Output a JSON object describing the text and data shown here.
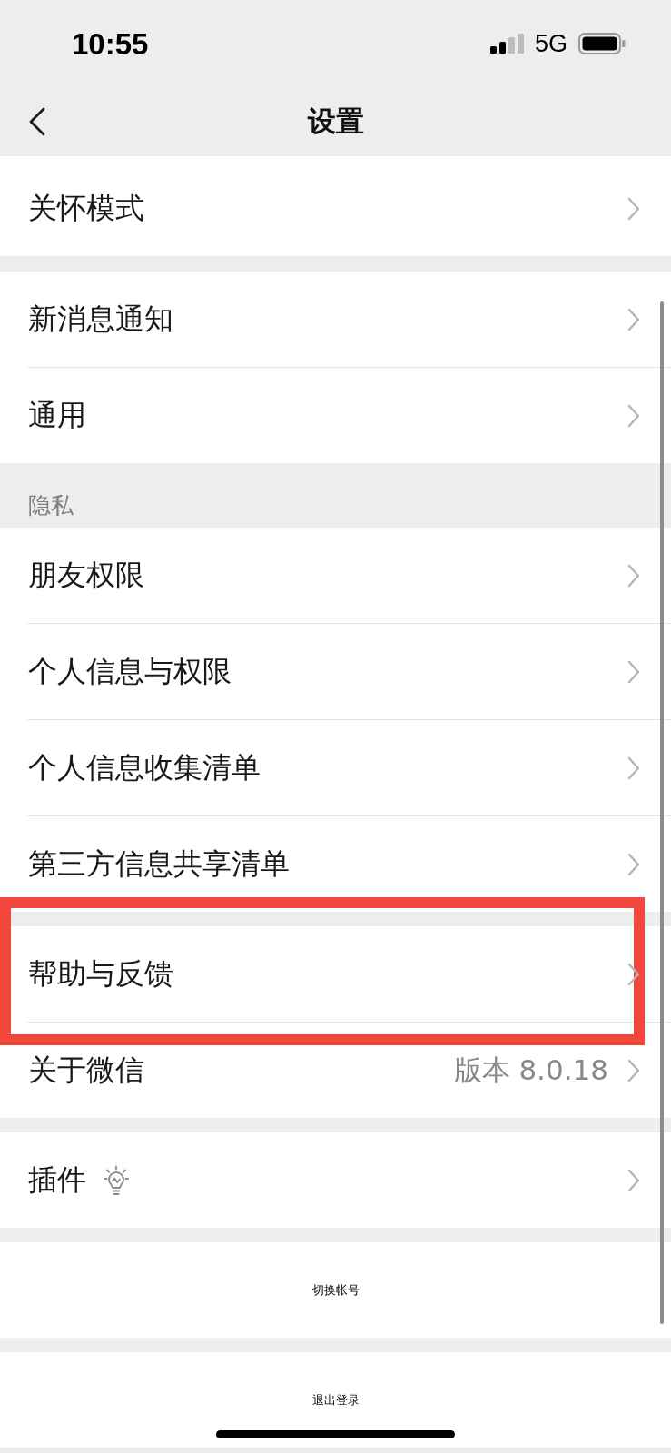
{
  "status_bar": {
    "time": "10:55",
    "network": "5G"
  },
  "nav_bar": {
    "title": "设置"
  },
  "groups": [
    {
      "items": [
        {
          "kind": "link",
          "label": "关怀模式",
          "highlighted": false
        }
      ]
    },
    {
      "items": [
        {
          "kind": "link",
          "label": "新消息通知",
          "highlighted": false
        },
        {
          "kind": "link",
          "label": "通用",
          "highlighted": false
        }
      ]
    },
    {
      "header": "隐私",
      "items": [
        {
          "kind": "link",
          "label": "朋友权限",
          "highlighted": false
        },
        {
          "kind": "link",
          "label": "个人信息与权限",
          "highlighted": false
        },
        {
          "kind": "link",
          "label": "个人信息收集清单",
          "highlighted": false
        },
        {
          "kind": "link",
          "label": "第三方信息共享清单",
          "highlighted": false
        }
      ]
    },
    {
      "items": [
        {
          "kind": "link",
          "label": "帮助与反馈",
          "highlighted": true
        },
        {
          "kind": "link",
          "label": "关于微信",
          "value": "版本 8.0.18",
          "highlighted": false
        }
      ]
    },
    {
      "items": [
        {
          "kind": "icon-link",
          "label": "插件",
          "highlighted": false
        }
      ]
    },
    {
      "items": [
        {
          "kind": "action",
          "label": "切换帐号",
          "highlighted": false
        }
      ]
    },
    {
      "items": [
        {
          "kind": "action",
          "label": "退出登录",
          "highlighted": false
        }
      ]
    }
  ]
}
